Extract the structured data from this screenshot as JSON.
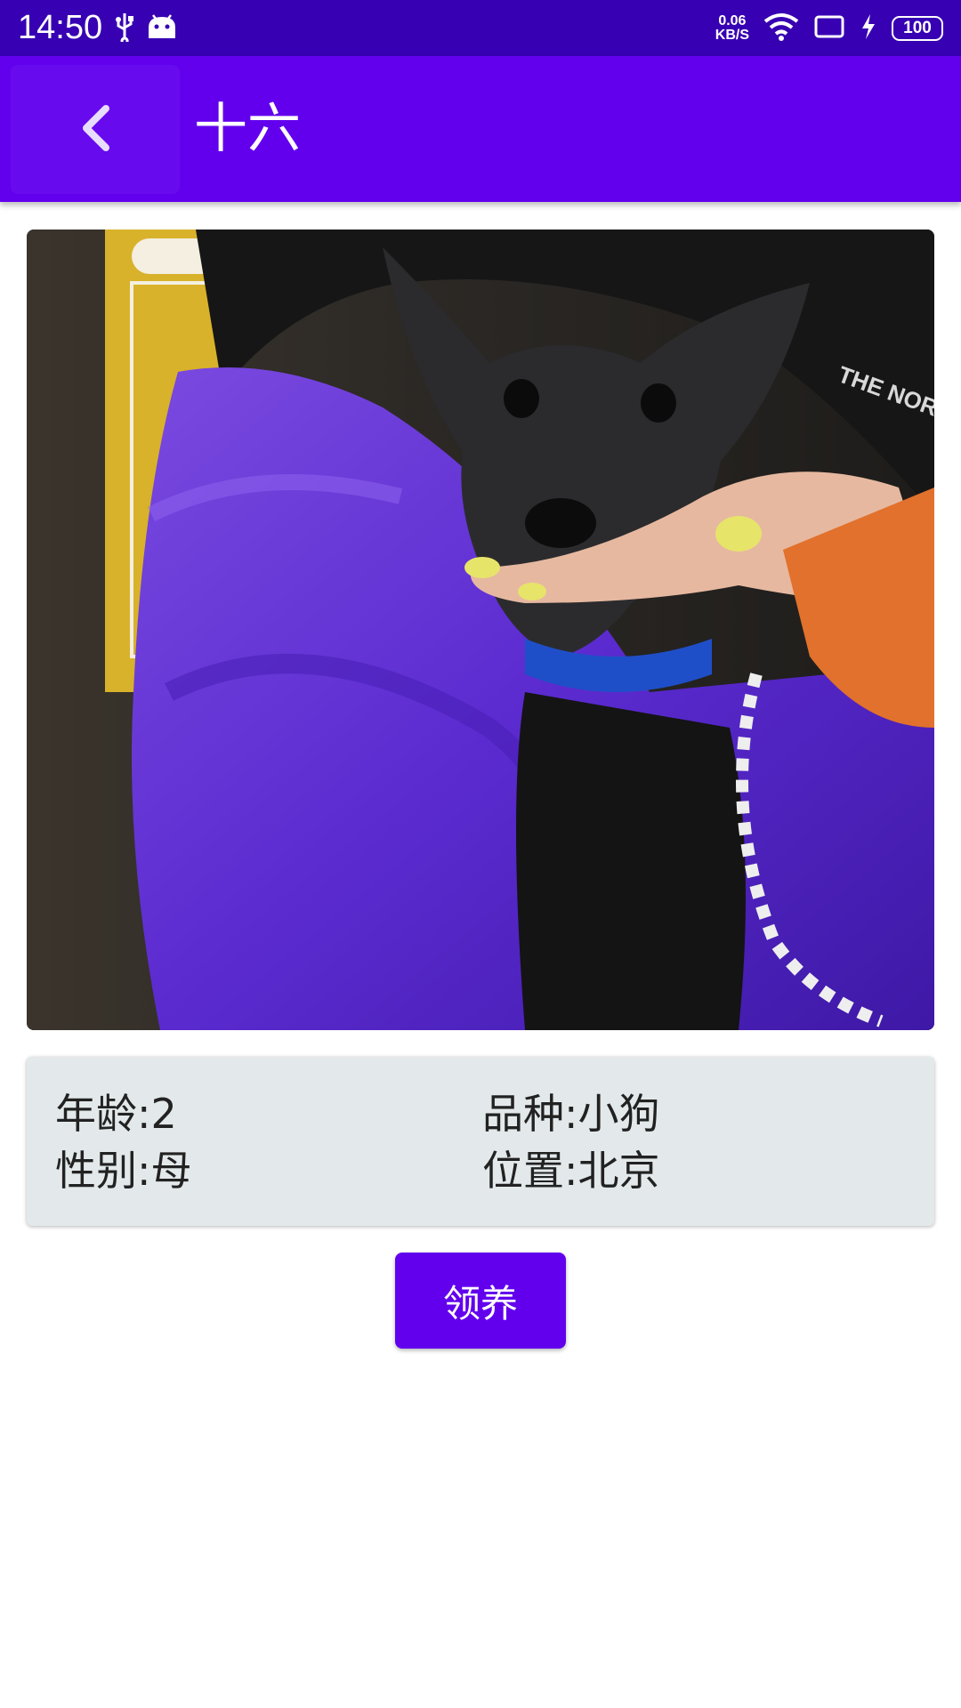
{
  "status_bar": {
    "time": "14:50",
    "net_speed_value": "0.06",
    "net_speed_unit": "KB/S",
    "battery": "100",
    "icons": [
      "usb-icon",
      "android-icon",
      "wifi-icon",
      "screen-icon",
      "charging-icon",
      "battery-icon"
    ]
  },
  "app_bar": {
    "title": "十六",
    "back_icon": "chevron-left-icon"
  },
  "pet": {
    "photo_alt": "dog-photo",
    "age": "年龄:2",
    "breed": "品种:小狗",
    "gender": "性别:母",
    "location": "位置:北京"
  },
  "actions": {
    "adopt_label": "领养"
  },
  "colors": {
    "status_bar": "#3700b3",
    "primary": "#6200ee",
    "card_bg": "#e3e9ea",
    "text": "#222222"
  }
}
